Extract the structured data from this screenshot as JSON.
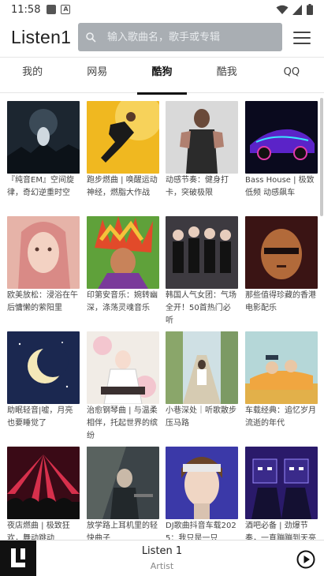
{
  "status_bar": {
    "time": "11:58"
  },
  "app": {
    "title": "Listen1"
  },
  "search": {
    "placeholder": "输入歌曲名，歌手或专辑"
  },
  "tabs": [
    {
      "label": "我的"
    },
    {
      "label": "网易"
    },
    {
      "label": "酷狗",
      "active": true
    },
    {
      "label": "酷我"
    },
    {
      "label": "QQ"
    }
  ],
  "playlists": [
    {
      "title": "『纯音EM』空间旋律，奇幻逆重时空"
    },
    {
      "title": "跑步燃曲 | 唤醒运动神经，燃脂大作战"
    },
    {
      "title": "动感节奏：健身打卡，突破极限"
    },
    {
      "title": "Bass House | 极致低频 动感飙车"
    },
    {
      "title": "欧美放松：浸浴在午后慵懒的萦阳里"
    },
    {
      "title": "印第安音乐：婉转幽深，涤荡灵魂音乐"
    },
    {
      "title": "韩国人气女团：气场全开！50首热门必听"
    },
    {
      "title": "那些值得珍藏的香港电影配乐"
    },
    {
      "title": "助眠轻音|嘘，月亮也要睡觉了"
    },
    {
      "title": "治愈钢琴曲 | 与温柔相伴，托起世界的缤纷"
    },
    {
      "title": "小巷深处｜听歌散步压马路"
    },
    {
      "title": "车载经典：追忆岁月流逝的年代"
    },
    {
      "title": "夜店燃曲 | 极致狂欢，舞动跳动"
    },
    {
      "title": "放学路上耳机里的轻快曲子"
    },
    {
      "title": "DJ歌曲抖音车载2025：我只是一只"
    },
    {
      "title": "酒吧必备 | 劲爆节奏，一直蹦蹦到天亮"
    }
  ],
  "player": {
    "title": "Listen 1",
    "artist": "Artist",
    "logo_letter": "L"
  },
  "colors": {
    "search_bg": "#a9aeb3",
    "accent": "#111111"
  }
}
